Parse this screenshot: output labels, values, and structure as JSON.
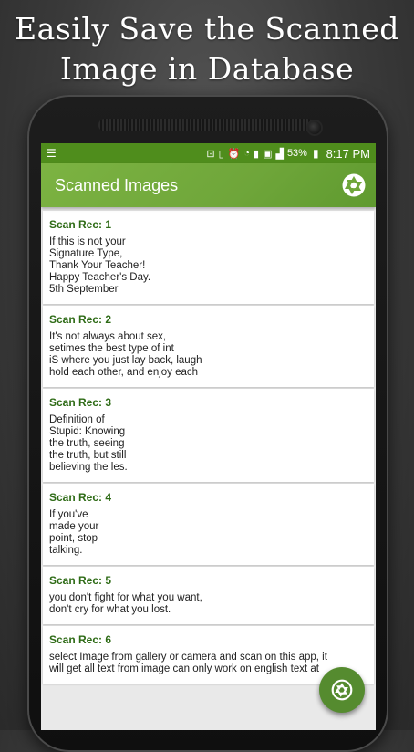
{
  "promo": {
    "line1": "Easily Save the Scanned",
    "line2": "Image in Database"
  },
  "status_bar": {
    "menu_icon": "list-icon",
    "battery": "53%",
    "time": "8:17 PM"
  },
  "app_bar": {
    "title": "Scanned Images",
    "action_icon": "camera-shutter-icon"
  },
  "records": [
    {
      "label": "Scan Rec: 1",
      "text": "If this is not your\nSignature Type,\nThank Your Teacher!\nHappy Teacher's Day.\n5th September"
    },
    {
      "label": "Scan Rec: 2",
      "text": "It's not always about sex,\nsetimes the best type of int\niS where you just lay back, laugh\nhold each other, and enjoy each"
    },
    {
      "label": "Scan Rec: 3",
      "text": "Definition of\nStupid: Knowing\nthe truth, seeing\nthe truth, but still\nbelieving the les."
    },
    {
      "label": "Scan Rec: 4",
      "text": "If you've\nmade your\npoint, stop\ntalking."
    },
    {
      "label": "Scan Rec: 5",
      "text": "you don't fight for what you want,\ndon't cry for what you lost."
    },
    {
      "label": "Scan Rec: 6",
      "text": "select Image from gallery or camera and scan on this app, it\nwill get all text from image can only work on english text at"
    }
  ],
  "colors": {
    "status_bar": "#4f8d1c",
    "app_bar": "#7cb342",
    "record_label": "#2e6b16",
    "fab": "#558b2f"
  }
}
